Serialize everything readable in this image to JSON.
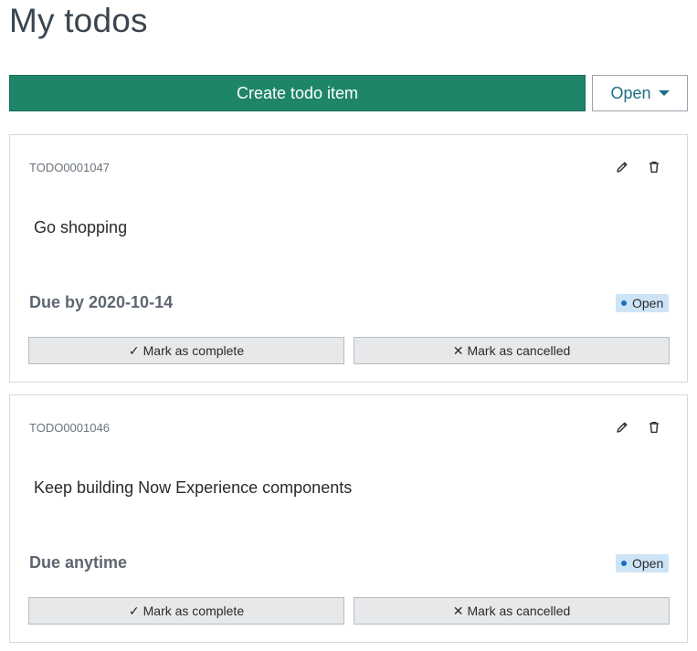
{
  "page": {
    "title": "My todos"
  },
  "toolbar": {
    "create_label": "Create todo item",
    "filter_value": "Open"
  },
  "todos": [
    {
      "id": "TODO0001047",
      "text": "Go shopping",
      "due": "Due by 2020-10-14",
      "status": "Open",
      "complete_label": "Mark as complete",
      "cancel_label": "Mark as cancelled"
    },
    {
      "id": "TODO0001046",
      "text": "Keep building Now Experience components",
      "due": "Due anytime",
      "status": "Open",
      "complete_label": "Mark as complete",
      "cancel_label": "Mark as cancelled"
    }
  ],
  "icons": {
    "edit": "pencil-icon",
    "delete": "trash-icon",
    "complete": "checkmark-icon",
    "cancel": "close-icon",
    "dropdown": "chevron-down-icon"
  },
  "colors": {
    "primary": "#1e8568",
    "accent": "#1e6e86",
    "badge_bg": "#cde4f7",
    "badge_dot": "#1a6fc0"
  }
}
